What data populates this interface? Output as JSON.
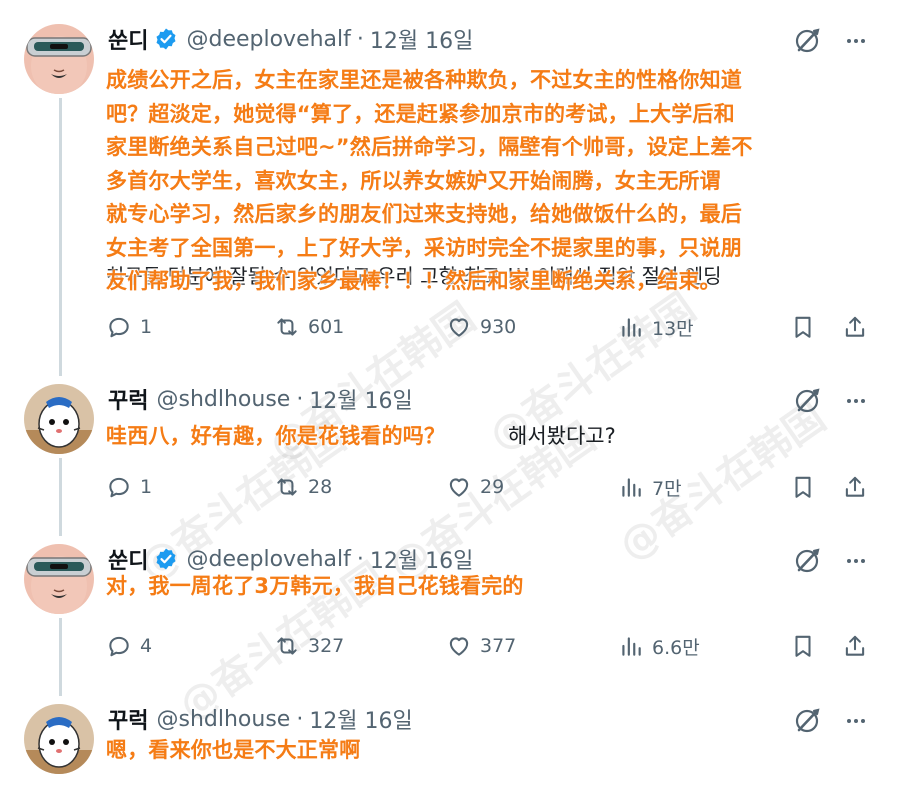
{
  "watermark_text": "@奋斗在韩国",
  "tweets": [
    {
      "display_name": "쑨디",
      "verified": true,
      "handle": "@deeplovehalf",
      "date": "12월 16일",
      "avatar": "masked-face-avatar",
      "text_lines": [
        "成绩公开之后，女主在家里还是被各种欺负，不过女主的性格你知道",
        "吧？超淡定，她觉得“算了，还是赶紧参加京市的考试，上大学后和",
        "家里断绝关系自己过吧~”然后拼命学习，隔壁有个帅哥，设定上差不",
        "多首尔大学生，喜欢女主，所以养女嫉妒又开始闹腾，女主无所谓",
        "就专心学习，然后家乡的朋友们过来支持她，给她做饭什么的，最后",
        "女主考了全国第一，上了好大学，采访时完全不提家里的事，只说朋",
        "友们帮助了我，我们家乡最棒！！！然后和家里断绝关系，结束。"
      ],
      "bottom_partial": "친구들 덕분에 잘될 수 있었다고 우리 고향 최고 !!! 이래서 집안 절연 엔딩",
      "stats": {
        "replies": "1",
        "reposts": "601",
        "likes": "930",
        "views": "13만"
      }
    },
    {
      "display_name": "꾸럭",
      "verified": false,
      "handle": "@shdlhouse",
      "date": "12월 16일",
      "avatar": "cartoon-egg-avatar",
      "text_lines": [
        "哇西八，好有趣，你是花钱看的吗？"
      ],
      "korean_suffix": "해서봤다고?",
      "stats": {
        "replies": "1",
        "reposts": "28",
        "likes": "29",
        "views": "7만"
      }
    },
    {
      "display_name": "쑨디",
      "verified": true,
      "handle": "@deeplovehalf",
      "date": "12월 16일",
      "avatar": "masked-face-avatar",
      "text_lines": [
        "对，我一周花了3万韩元，我自己花钱看完的"
      ],
      "stats": {
        "replies": "4",
        "reposts": "327",
        "likes": "377",
        "views": "6.6만"
      }
    },
    {
      "display_name": "꾸럭",
      "verified": false,
      "handle": "@shdlhouse",
      "date": "12월 16일",
      "avatar": "cartoon-egg-avatar",
      "text_lines": [
        "嗯，看来你也是不大正常啊"
      ]
    }
  ]
}
